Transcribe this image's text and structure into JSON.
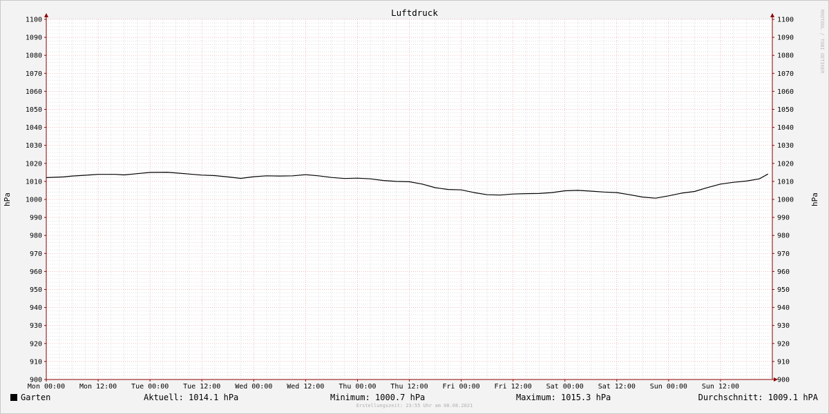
{
  "chart_data": {
    "type": "line",
    "title": "Luftdruck",
    "ylabel": "hPa",
    "ylim": [
      900,
      1100
    ],
    "y_ticks": [
      900,
      910,
      920,
      930,
      940,
      950,
      960,
      970,
      980,
      990,
      1000,
      1010,
      1020,
      1030,
      1040,
      1050,
      1060,
      1070,
      1080,
      1090,
      1100
    ],
    "x_range_hours": [
      0,
      168
    ],
    "x_tick_hours": [
      0,
      12,
      24,
      36,
      48,
      60,
      72,
      84,
      96,
      108,
      120,
      132,
      144,
      156
    ],
    "x_ticks": [
      "Mon 00:00",
      "Mon 12:00",
      "Tue 00:00",
      "Tue 12:00",
      "Wed 00:00",
      "Wed 12:00",
      "Thu 00:00",
      "Thu 12:00",
      "Fri 00:00",
      "Fri 12:00",
      "Sat 00:00",
      "Sat 12:00",
      "Sun 00:00",
      "Sun 12:00"
    ],
    "grid": true,
    "legend_position": "bottom-left",
    "series": [
      {
        "name": "Garten",
        "color": "#000000",
        "x": [
          0,
          4,
          6,
          9,
          12,
          16,
          18,
          21,
          24,
          28,
          30,
          33,
          36,
          39,
          42,
          45,
          48,
          51,
          54,
          57,
          60,
          63,
          66,
          69,
          72,
          75,
          78,
          81,
          84,
          87,
          90,
          93,
          96,
          99,
          102,
          105,
          108,
          111,
          114,
          117,
          120,
          123,
          126,
          129,
          132,
          135,
          138,
          141,
          144,
          147,
          150,
          153,
          156,
          159,
          162,
          165,
          167
        ],
        "values": [
          1012.1,
          1012.5,
          1013,
          1013.4,
          1013.9,
          1013.9,
          1013.6,
          1014.3,
          1015,
          1015.1,
          1014.7,
          1014.1,
          1013.5,
          1013.2,
          1012.5,
          1011.7,
          1012.6,
          1013.1,
          1013,
          1013.1,
          1013.7,
          1013.1,
          1012.2,
          1011.6,
          1011.8,
          1011.4,
          1010.5,
          1010,
          1009.8,
          1008.5,
          1006.5,
          1005.5,
          1005.3,
          1003.8,
          1002.6,
          1002.4,
          1003,
          1003.2,
          1003.3,
          1003.8,
          1004.8,
          1005,
          1004.6,
          1004.1,
          1003.8,
          1002.6,
          1001.3,
          1000.7,
          1002,
          1003.5,
          1004.4,
          1006.6,
          1008.5,
          1009.5,
          1010.2,
          1011.4,
          1014.1
        ]
      }
    ]
  },
  "legend": {
    "name": "Garten",
    "current": "Aktuell: 1014.1 hPa",
    "minimum": "Minimum: 1000.7 hPa",
    "maximum": "Maximum: 1015.3 hPa",
    "average": "Durchschnitt: 1009.1 hPA"
  },
  "footer": "Erstellungszeit: 23:55 Uhr am 08.08.2021",
  "watermark": "RRDTOOL / TOBI OETIKER",
  "colors": {
    "background": "#f3f3f3",
    "canvas": "#ffffff",
    "major_grid": "#e8a0a0",
    "minor_grid": "#c8c8c8",
    "axis": "#8b0000",
    "line": "#000000"
  }
}
